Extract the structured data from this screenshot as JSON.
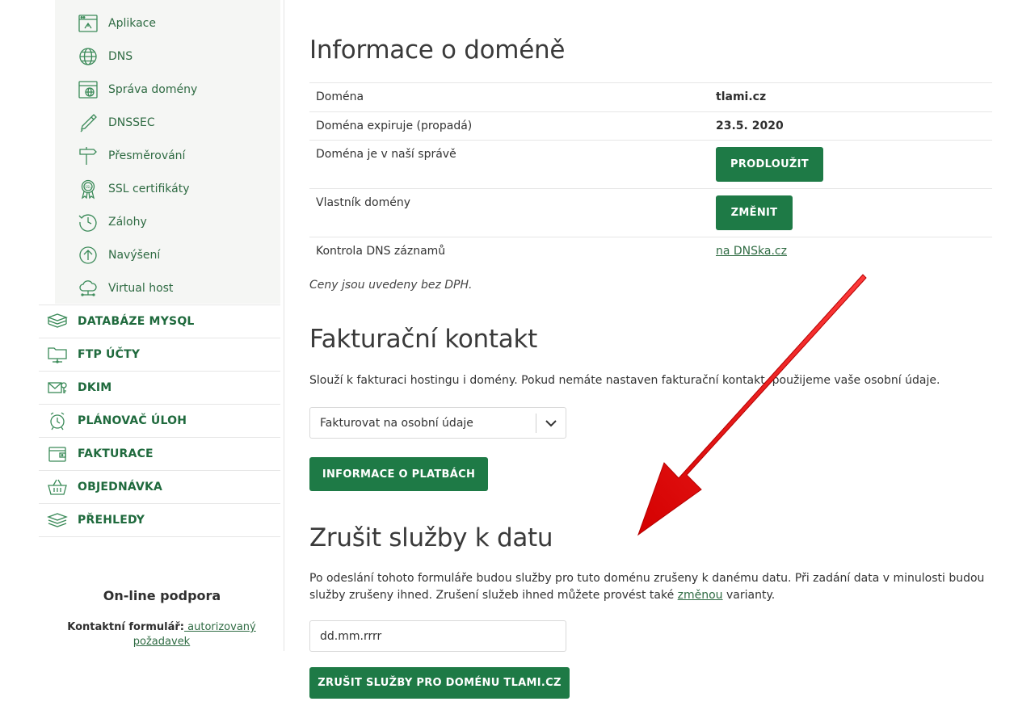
{
  "sidebar": {
    "submenu": [
      {
        "label": "Aplikace",
        "icon": "app-window-icon"
      },
      {
        "label": "DNS",
        "icon": "globe-icon"
      },
      {
        "label": "Správa domény",
        "icon": "domain-admin-icon"
      },
      {
        "label": "DNSSEC",
        "icon": "key-pen-icon"
      },
      {
        "label": "Přesměrování",
        "icon": "signpost-icon"
      },
      {
        "label": "SSL certifikáty",
        "icon": "ssl-badge-icon"
      },
      {
        "label": "Zálohy",
        "icon": "backup-clock-icon"
      },
      {
        "label": "Navýšení",
        "icon": "arrow-up-circle-icon"
      },
      {
        "label": "Virtual host",
        "icon": "cloud-network-icon"
      }
    ],
    "main": [
      {
        "label": "DATABÁZE MYSQL",
        "icon": "database-icon"
      },
      {
        "label": "FTP ÚČTY",
        "icon": "ftp-folder-icon"
      },
      {
        "label": "DKIM",
        "icon": "mail-key-icon"
      },
      {
        "label": "PLÁNOVAČ ÚLOH",
        "icon": "alarm-clock-icon"
      },
      {
        "label": "FAKTURACE",
        "icon": "wallet-icon"
      },
      {
        "label": "OBJEDNÁVKA",
        "icon": "basket-icon"
      },
      {
        "label": "PŘEHLEDY",
        "icon": "stack-icon"
      }
    ],
    "support": {
      "title": "On-line podpora",
      "contact_label": "Kontaktní formulář:",
      "contact_link": " autorizovaný požadavek"
    }
  },
  "domain_info": {
    "title": "Informace o doméně",
    "rows": {
      "domain": {
        "label": "Doména",
        "value": "tlami.cz"
      },
      "expires": {
        "label": "Doména expiruje (propadá)",
        "value": "23.5. 2020"
      },
      "managed": {
        "label": "Doména je v naší správě",
        "button": "PRODLOUŽIT"
      },
      "owner": {
        "label": "Vlastník domény",
        "button": "ZMĚNIT"
      },
      "dns_check": {
        "label": "Kontrola DNS záznamů",
        "link": "na DNSka.cz"
      }
    },
    "note": "Ceny jsou uvedeny bez DPH."
  },
  "billing": {
    "title": "Fakturační kontakt",
    "description": "Slouží k fakturaci hostingu i domény. Pokud nemáte nastaven fakturační kontakt, použijeme vaše osobní údaje.",
    "select_value": "Fakturovat na osobní údaje",
    "payments_button": "INFORMACE O PLATBÁCH"
  },
  "cancel": {
    "title": "Zrušit služby k datu",
    "description_1": "Po odeslání tohoto formuláře budou služby pro tuto doménu zrušeny k danému datu. Při zadání data v minulosti budou služby zrušeny ihned. Zrušení služeb ihned můžete provést také ",
    "description_link": "změnou",
    "description_2": " varianty.",
    "date_placeholder": "dd.mm.rrrr",
    "submit_button": "ZRUŠIT SLUŽBY PRO DOMÉNU TLAMI.CZ"
  },
  "colors": {
    "accent": "#1e7a46",
    "link": "#2f6b43",
    "annotation_arrow": "#e10000"
  }
}
